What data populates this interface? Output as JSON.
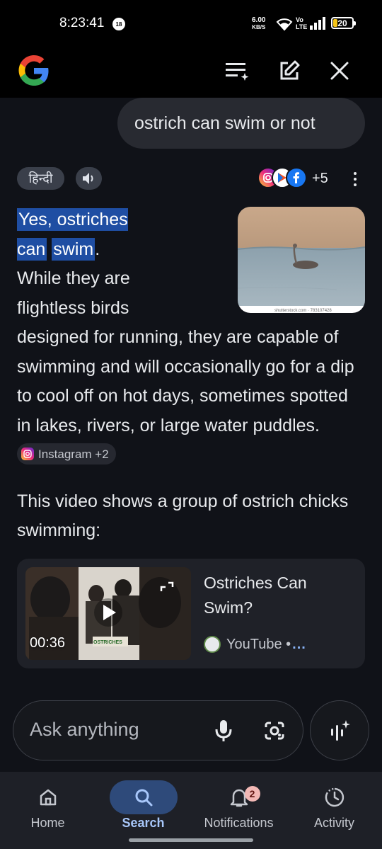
{
  "status_bar": {
    "time": "8:23:41",
    "notif_count": "18",
    "speed_value": "6.00",
    "speed_unit": "KB/S",
    "volte_line1": "Vo",
    "volte_line2": "LTE",
    "battery": "20",
    "battery_level": 0.2
  },
  "app_bar": {
    "logo_icon": "google-g-logo",
    "history_icon": "history-list-icon",
    "edit_icon": "new-chat-icon",
    "close_icon": "close-icon"
  },
  "query": "ostrich can swim or not",
  "controls": {
    "language": "हिन्दी",
    "speaker_icon": "volume-icon",
    "source_icons": [
      "instagram",
      "play-store",
      "facebook"
    ],
    "more_sources": "+5"
  },
  "answer": {
    "highlight_line1": "Yes, ostriches can",
    "highlight_line2": "swim",
    "rest": ". While they are flightless birds designed for running, they are capable of swimming and will occasionally go for a dip to cool off on hot days, sometimes spotted in lakes, rivers, or large water puddles.",
    "source_chip": "Instagram +2",
    "image_watermark": "shutterstock.com · 783107428"
  },
  "video_intro": "This video shows a group of ostrich chicks swimming:",
  "video_card": {
    "duration": "00:36",
    "title": "Ostriches Can Swim?",
    "source": "YouTube •",
    "more": "...",
    "thumb_caption": "OSTRICHES"
  },
  "ask_bar": {
    "placeholder": "Ask anything"
  },
  "bottom_nav": {
    "items": [
      {
        "label": "Home",
        "icon": "home-icon"
      },
      {
        "label": "Search",
        "icon": "search-icon"
      },
      {
        "label": "Notifications",
        "icon": "bell-icon"
      },
      {
        "label": "Activity",
        "icon": "activity-icon"
      }
    ],
    "active": "Search",
    "notif_badge": "2"
  },
  "colors": {
    "background": "#101218",
    "highlight": "#1f4ea3",
    "accent": "#a8c7fa",
    "badge": "#f2b8b5"
  }
}
